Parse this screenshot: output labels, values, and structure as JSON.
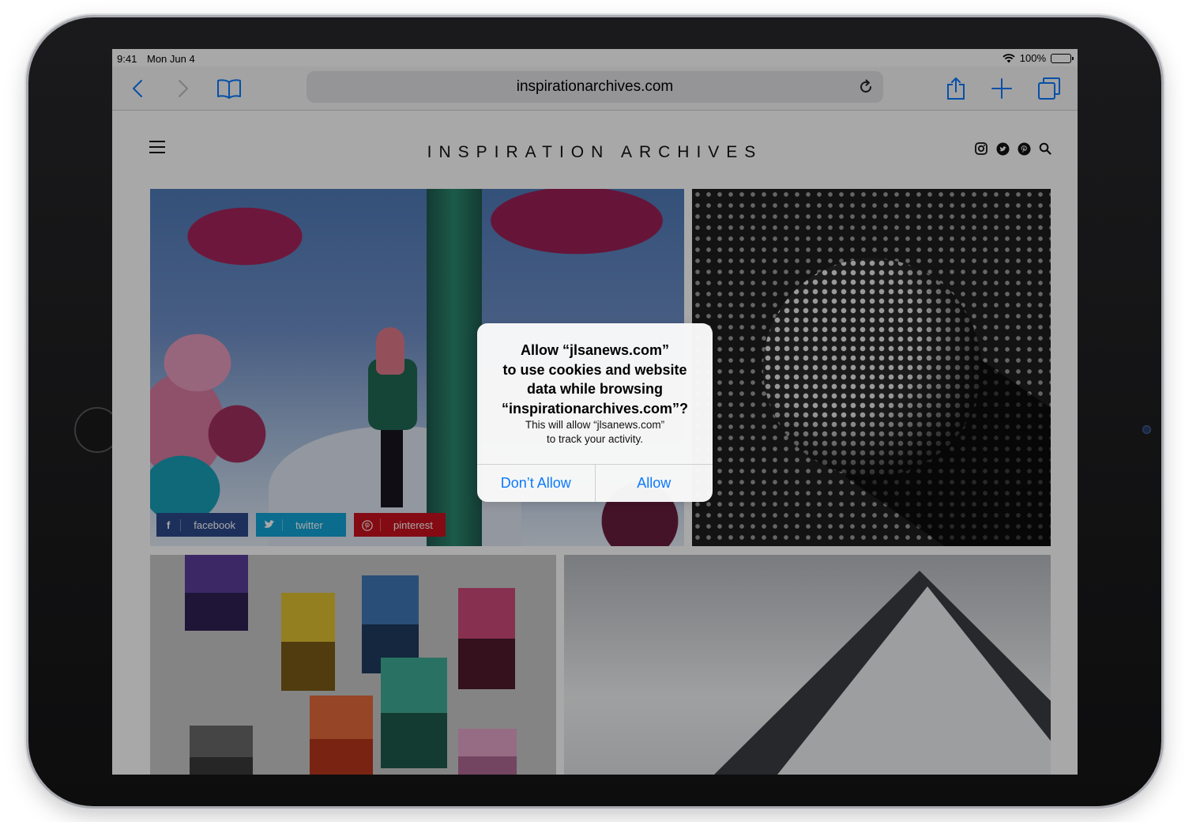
{
  "status_bar": {
    "time": "9:41",
    "date": "Mon Jun 4",
    "battery": "100%"
  },
  "browser": {
    "url": "inspirationarchives.com",
    "accent_color": "#0a7aff",
    "icons": [
      "back-icon",
      "forward-icon",
      "bookmarks-icon",
      "reload-icon",
      "share-icon",
      "new-tab-icon",
      "tabs-icon"
    ]
  },
  "site": {
    "title": "INSPIRATION ARCHIVES",
    "social_icons": [
      "instagram-icon",
      "twitter-icon",
      "pinterest-icon",
      "search-icon"
    ],
    "share_buttons": {
      "facebook": {
        "glyph": "f",
        "label": "facebook",
        "color": "#2d4a8c"
      },
      "twitter": {
        "glyph": "🐦",
        "label": "twitter",
        "color": "#12a5d8"
      },
      "pinterest": {
        "glyph": "℗",
        "label": "pinterest",
        "color": "#c8121d"
      }
    }
  },
  "alert": {
    "title_lines": [
      "Allow “jlsanews.com”",
      "to use cookies and website",
      "data while browsing",
      "“inspirationarchives.com”?"
    ],
    "message_lines": [
      "This will allow “jlsanews.com”",
      "to track your activity."
    ],
    "deny_label": "Don’t Allow",
    "allow_label": "Allow"
  }
}
